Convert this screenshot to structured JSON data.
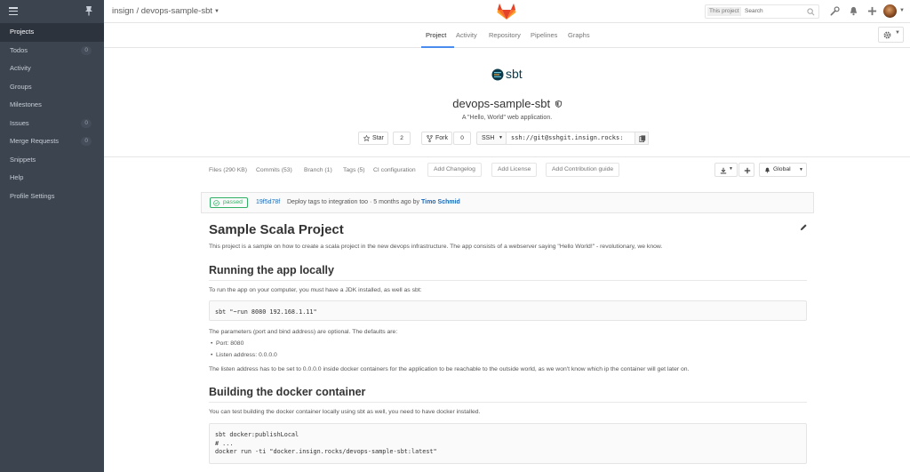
{
  "sidebar": {
    "items": [
      {
        "label": "Projects",
        "active": true
      },
      {
        "label": "Todos",
        "count": "0"
      },
      {
        "label": "Activity"
      },
      {
        "label": "Groups"
      },
      {
        "label": "Milestones"
      },
      {
        "label": "Issues",
        "count": "0"
      },
      {
        "label": "Merge Requests",
        "count": "0"
      },
      {
        "label": "Snippets"
      },
      {
        "label": "Help"
      },
      {
        "label": "Profile Settings"
      }
    ]
  },
  "header": {
    "breadcrumb": "insign / devops-sample-sbt",
    "search_scope": "This project",
    "search_placeholder": "Search"
  },
  "subnav": {
    "tabs": [
      "Project",
      "Activity",
      "Repository",
      "Pipelines",
      "Graphs"
    ],
    "active": "Project"
  },
  "project": {
    "logo_text": "sbt",
    "name": "devops-sample-sbt",
    "description": "A \"Hello, World\" web application.",
    "star_label": "Star",
    "star_count": "2",
    "fork_label": "Fork",
    "fork_count": "0",
    "protocol": "SSH",
    "clone_url": "ssh://git@sshgit.insign.rocks:"
  },
  "files_bar": {
    "links": [
      "Files (290 KB)",
      "Commits (53)",
      "Branch (1)",
      "Tags (5)",
      "CI configuration"
    ],
    "buttons": [
      "Add Changelog",
      "Add License",
      "Add Contribution guide"
    ],
    "notification": "Global"
  },
  "commit": {
    "status": "passed",
    "sha": "19f5d78f",
    "message": "Deploy tags to integration too · 5 months ago by ",
    "author": "Timo Schmid"
  },
  "readme": {
    "title": "Sample Scala Project",
    "intro": "This project is a sample on how to create a scala project in the new devops infrastructure. The app consists of a webserver saying \"Hello World!\" - revolutionary, we know.",
    "h_run": "Running the app locally",
    "run_text": "To run the app on your computer, you must have a JDK installed, as well as sbt:",
    "run_code": "sbt \"~run 8080 192.168.1.11\"",
    "params_text": "The parameters (port and bind address) are optional. The defaults are:",
    "params": [
      "Port: 8080",
      "Listen address: 0.0.0.0"
    ],
    "listen_text": "The listen address has to be set to 0.0.0.0 inside docker containers for the application to be reachable to the outside world, as we won't know which ip the container will get later on.",
    "h_build": "Building the docker container",
    "build_text": "You can test building the docker container locally using sbt as well, you need to have docker installed.",
    "build_code": [
      "sbt docker:publishLocal",
      "# ...",
      "docker run -ti \"docker.insign.rocks/devops-sample-sbt:latest\""
    ]
  },
  "colors": {
    "sidebar_bg": "#3c444f",
    "accent": "#4a8bee",
    "link": "#1b69b6",
    "success": "#31af64",
    "gitlab_orange": "#e24329"
  }
}
